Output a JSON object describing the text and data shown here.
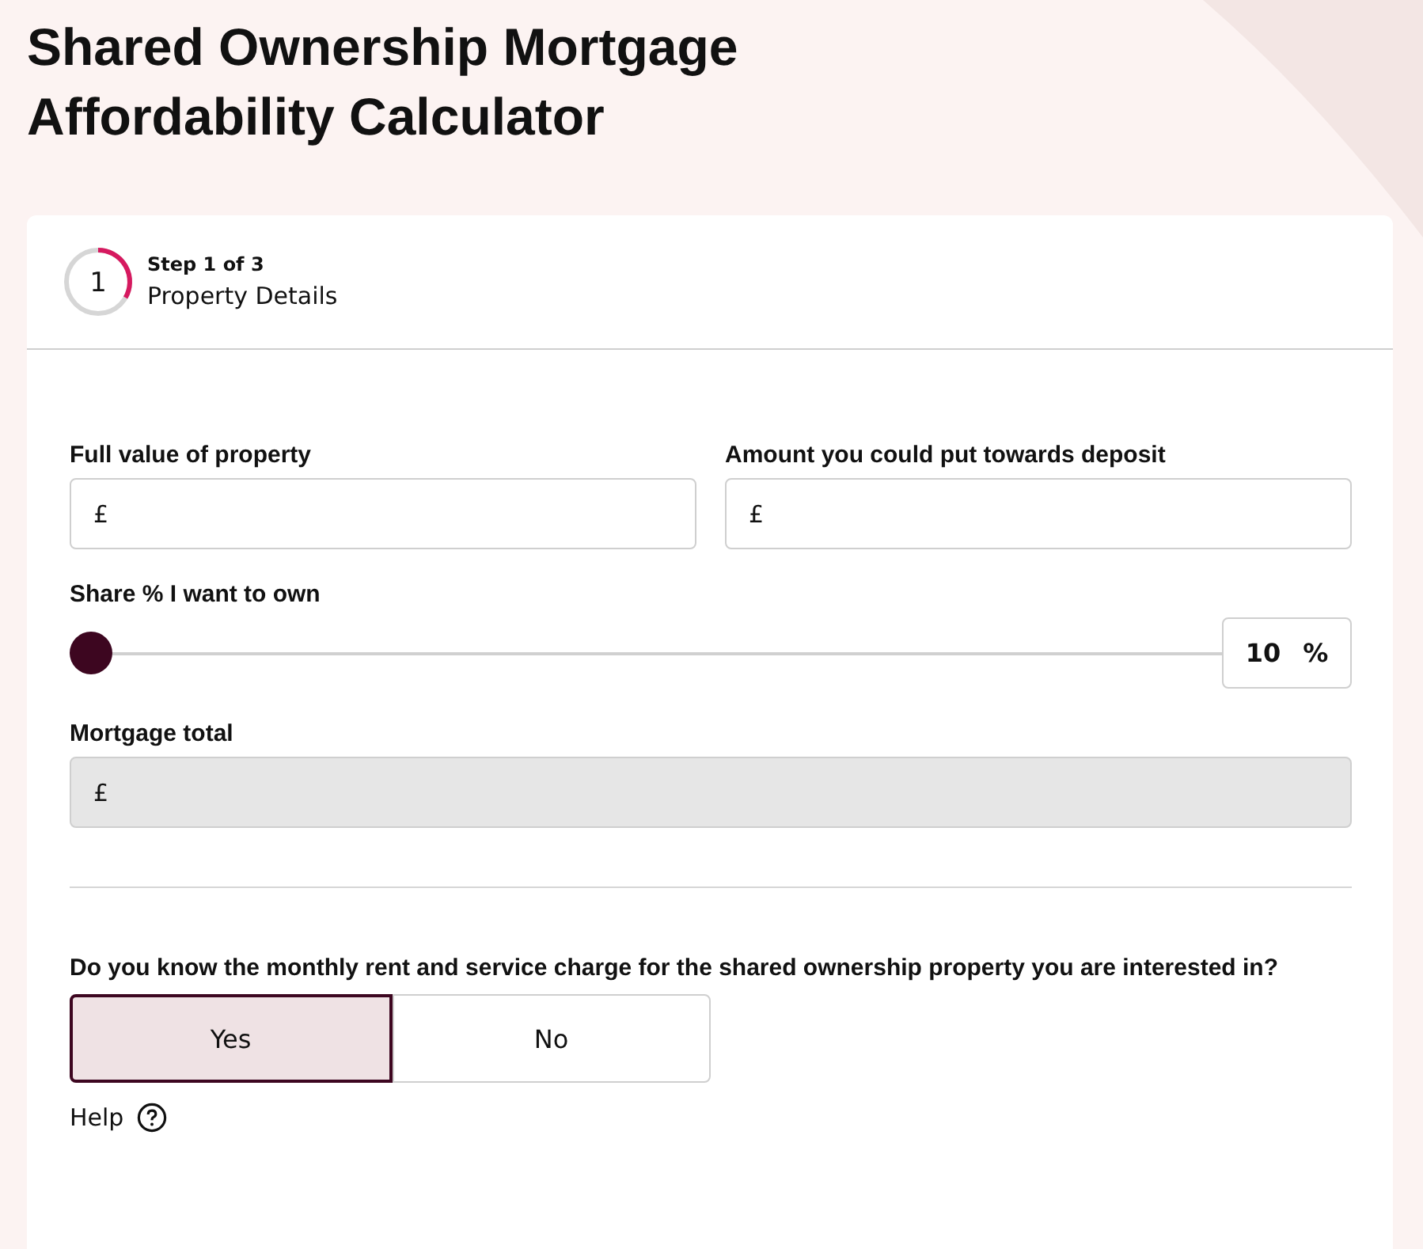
{
  "title": "Shared Ownership Mortgage Affordability Calculator",
  "step": {
    "number": "1",
    "caption": "Step 1 of 3",
    "name": "Property Details"
  },
  "fields": [
    {
      "label": "Full value of property",
      "prefix": "£"
    },
    {
      "label": "Amount you could put towards deposit",
      "prefix": "£"
    }
  ],
  "share": {
    "label": "Share % I want to own",
    "level": 0,
    "value": "10",
    "unit": "%"
  },
  "mortgage_total": {
    "label": "Mortgage total",
    "prefix": "£",
    "disabled": true
  },
  "question": {
    "text": "Do you know the monthly rent and service charge for the shared ownership property you are interested in?",
    "options": [
      {
        "label": "Yes",
        "selected": true
      },
      {
        "label": "No",
        "selected": false
      }
    ]
  },
  "help": {
    "label": "Help"
  }
}
